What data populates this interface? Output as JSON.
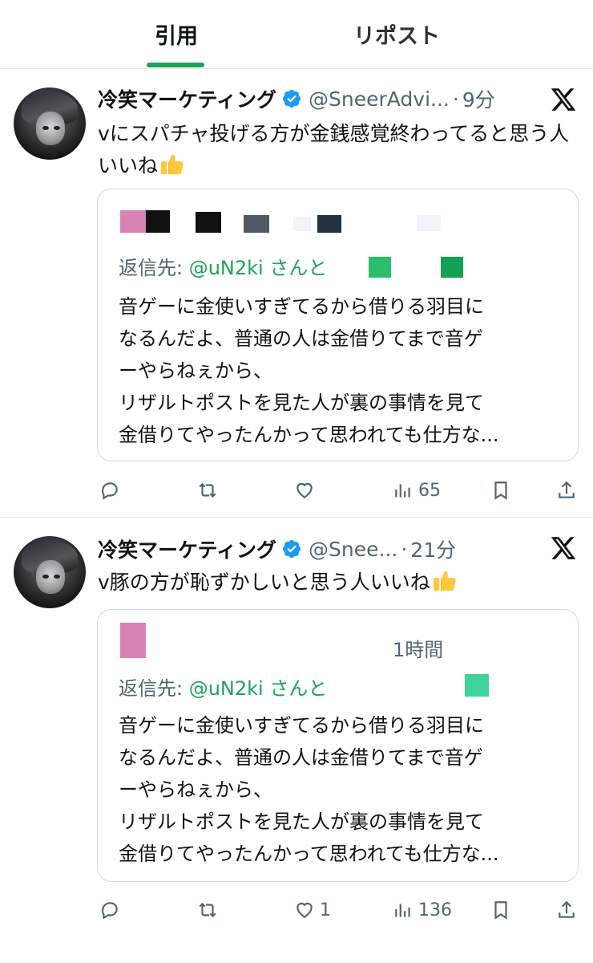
{
  "tabs": [
    {
      "label": "引用",
      "active": true
    },
    {
      "label": "リポスト",
      "active": false
    }
  ],
  "accent_color": "#1da25b",
  "verified_color": "#1d9bf0",
  "tweets": [
    {
      "name": "冷笑マーケティング",
      "handle": "@SneerAdvi...",
      "sep": "·",
      "time": "9分",
      "text": "vにスパチャ投げる方が金銭感覚終わってると思う人いいね",
      "emoji": "thumbs-up",
      "quote": {
        "time": "",
        "reply_prefix": "返信先: ",
        "reply_mention": "@uN2ki さんと",
        "lines": [
          "音ゲーに金使いすぎてるから借りる羽目に",
          "なるんだよ、普通の人は金借りてまで音ゲ",
          "ーやらねぇから、",
          "リザルトポストを見た人が裏の事情を見て",
          "金借りてやったんかって思われても仕方な..."
        ]
      },
      "actions": {
        "reply": "",
        "repost": "",
        "like": "",
        "views": "65"
      }
    },
    {
      "name": "冷笑マーケティング",
      "handle": "@Snee...",
      "sep": "·",
      "time": "21分",
      "text": "v豚の方が恥ずかしいと思う人いいね",
      "emoji": "thumbs-up",
      "quote": {
        "time": "1時間",
        "reply_prefix": "返信先: ",
        "reply_mention": "@uN2ki さんと",
        "lines": [
          "音ゲーに金使いすぎてるから借りる羽目に",
          "なるんだよ、普通の人は金借りてまで音ゲ",
          "ーやらねぇから、",
          "リザルトポストを見た人が裏の事情を見て",
          "金借りてやったんかって思われても仕方な..."
        ]
      },
      "actions": {
        "reply": "",
        "repost": "",
        "like": "1",
        "views": "136"
      }
    }
  ]
}
